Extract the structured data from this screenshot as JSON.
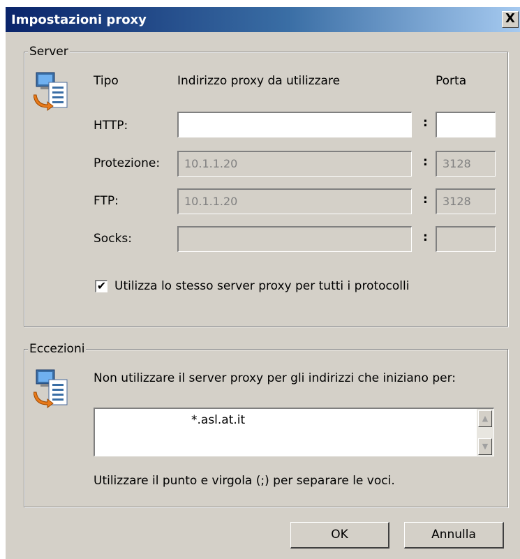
{
  "window": {
    "title": "Impostazioni proxy",
    "close_label": "X"
  },
  "server": {
    "legend": "Server",
    "header_type": "Tipo",
    "header_address": "Indirizzo proxy da utilizzare",
    "header_port": "Porta",
    "colon": ":",
    "rows": [
      {
        "label": "HTTP:",
        "address": "",
        "port": ""
      },
      {
        "label": "Protezione:",
        "address": "10.1.1.20",
        "port": "3128"
      },
      {
        "label": "FTP:",
        "address": "10.1.1.20",
        "port": "3128"
      },
      {
        "label": "Socks:",
        "address": "",
        "port": ""
      }
    ],
    "same_proxy_checked": true,
    "same_proxy_check_mark": "✔",
    "same_proxy_label": "Utilizza lo stesso server proxy per tutti i protocolli"
  },
  "exceptions": {
    "legend": "Eccezioni",
    "description": "Non utilizzare il server proxy per gli indirizzi che iniziano per:",
    "value": "*.asl.at.it",
    "hint": "Utilizzare il punto e virgola (;) per separare le voci."
  },
  "buttons": {
    "ok": "OK",
    "cancel": "Annulla"
  },
  "icons": {
    "scroll_up": "▲",
    "scroll_down": "▼"
  },
  "colors": {
    "title_start": "#0a246a",
    "title_end": "#a6caf0",
    "dialog_bg": "#d4d0c8"
  }
}
